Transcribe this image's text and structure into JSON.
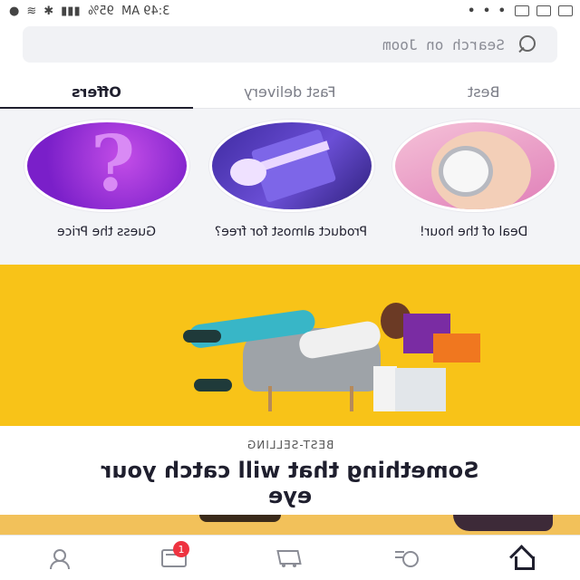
{
  "status_bar": {
    "time": "3:49 AM",
    "battery": "95%"
  },
  "search": {
    "placeholder": "Search on Joom"
  },
  "tabs": [
    {
      "label": "Offers",
      "active": true
    },
    {
      "label": "Fast delivery",
      "active": false
    },
    {
      "label": "Best",
      "active": false
    }
  ],
  "offers": [
    {
      "title": "Guess the Price"
    },
    {
      "title": "Product almost for free?"
    },
    {
      "title": "Deal of the hour!"
    }
  ],
  "best_selling": {
    "eyebrow": "BEST-SELLING",
    "headline": "Something that will catch your eye"
  },
  "bottom_nav": {
    "items": [
      {
        "icon": "profile-icon"
      },
      {
        "icon": "wallet-icon",
        "badge": "1"
      },
      {
        "icon": "cart-icon"
      },
      {
        "icon": "search-chat-icon"
      },
      {
        "icon": "home-icon",
        "active": true
      }
    ]
  },
  "colors": {
    "banner": "#f8c318",
    "badge": "#ee3340",
    "accent_text": "#1f1f2e"
  }
}
